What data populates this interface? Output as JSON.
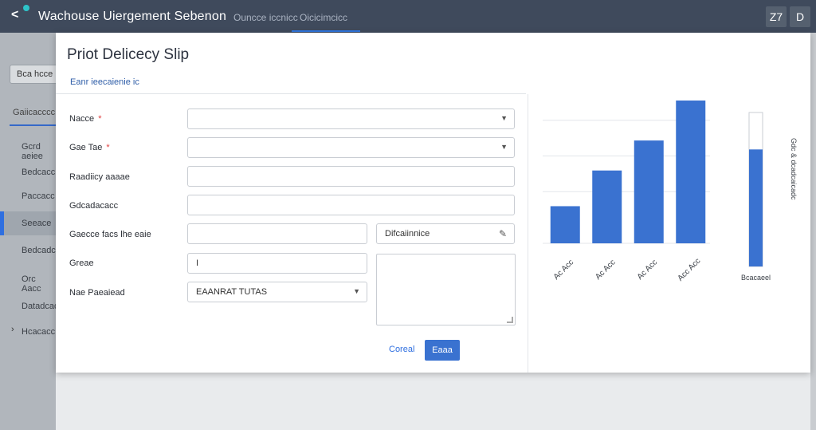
{
  "app": {
    "title": "Wachouse Uiergement Sebenon",
    "nav": [
      "Ouncce iccnicc",
      "Oicicimcicc"
    ],
    "top_buttons": [
      "Z7",
      "D"
    ]
  },
  "sidebar": {
    "button_label": "Bca hcce",
    "section_label": "Gaiicacccc",
    "items": [
      "Gcrd aeiee",
      "Bedcacc",
      "Paccacc",
      "Seeace",
      "Bedcadcc",
      "Orc Aacc",
      "Datadcadc",
      "Hcacacc"
    ]
  },
  "modal": {
    "title": "Priot Delicecy Slip",
    "subtitle": "Eanr ieecaienie ic",
    "fields": [
      {
        "label": "Nacce",
        "required": true,
        "value": ""
      },
      {
        "label": "Gae Tae",
        "required": true,
        "value": ""
      },
      {
        "label": "Raadiicy aaaae",
        "required": false,
        "value": ""
      },
      {
        "label": "Gdcadacacc",
        "required": false,
        "value": ""
      },
      {
        "label": "Gaecce facs lhe eaie",
        "required": false,
        "value": "",
        "side_value": "Difcaiinnice"
      },
      {
        "label": "Greae",
        "required": false,
        "value": "I"
      },
      {
        "label": "Nae Paeaiead",
        "required": false,
        "value": "EAANRAT TUTAS"
      }
    ],
    "cancel_label": "Coreal",
    "save_label": "Eaaa"
  },
  "colors": {
    "topbar": "#3f4a5c",
    "accent": "#3a72d0",
    "bar": "#3a72d0"
  },
  "chart_data": {
    "type": "bar",
    "categories": [
      "Ac Acc",
      "Ac Acc",
      "Ac Acc",
      "Acc Acc"
    ],
    "values": [
      26,
      51,
      72,
      100
    ],
    "ylim": [
      0,
      100
    ],
    "grid": true,
    "side_gauge": {
      "label": "Gdc & dcadcaicadc",
      "bottom_label": "Bcacaeel",
      "fill_fraction": 0.76
    }
  }
}
